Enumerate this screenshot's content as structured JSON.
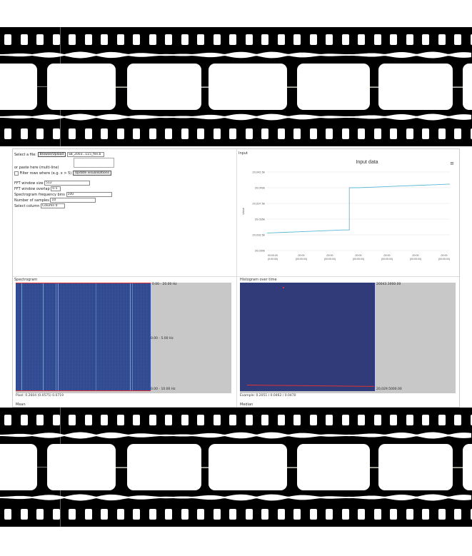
{
  "controls": {
    "select_file_label": "Select a file:",
    "browse_label": "Browse/Upload",
    "file_name": "SB_2003...L15_file.b",
    "or_paste_label": "or paste here (multi-line)",
    "filter_label": "Filter rows where",
    "filter_example": "(e.g. x > 5)",
    "update_label": "Update visualisations",
    "fft_label": "FFT window size",
    "fft_value": "512",
    "fft_overlap_label": "FFT window overlap",
    "fft_overlap_value": "0.5",
    "spec_freq_label": "Spectrogram frequency bins",
    "spec_freq_value": "100",
    "num_samples_label": "Number of samples",
    "num_samples_value": "10",
    "select_col_label": "Select column",
    "select_col_value": "Column 0"
  },
  "input_panel": {
    "title": "Input",
    "menu_icon": "hamburger-icon"
  },
  "chart_data": {
    "type": "line",
    "title": "Input data",
    "ylabel": "Value",
    "y_ticks": [
      "20,042.5k",
      "20,040k",
      "20,037.5k",
      "20,035k",
      "20,032.5k",
      "20,030k"
    ],
    "x_ticks": [
      "00:00:00\n(0:00:00)",
      "00:00\n(00:00:00)",
      "00:00\n(00:00:00)",
      "00:00\n(00:00:00)",
      "00:00\n(00:00:00)",
      "00:00\n(00:00:00)",
      "00:00\n(00:00:00)"
    ],
    "ylim": [
      20030,
      20043
    ],
    "x": [
      0,
      1,
      2,
      3,
      4,
      5,
      6,
      7,
      8,
      9,
      10,
      11,
      12
    ],
    "series": [
      {
        "values": [
          20032.9,
          20033.0,
          20033.1,
          20033.2,
          20033.3,
          20033.4,
          20040.4,
          20040.5,
          20040.6,
          20040.7,
          20040.8,
          20040.9,
          20041.0
        ],
        "color": "#5bb8d6"
      }
    ]
  },
  "spectrogram": {
    "title": "Spectrogram",
    "label_top": "0.00 - 20.00 Hz",
    "label_mid": "0.00 - 5.00 Hz",
    "label_bottom": "0.00 - 10.00 Hz",
    "footer": "Pixel: 0.2604 (0.0575) 0.0719"
  },
  "histogram": {
    "title": "Histogram over time",
    "label_top": "20043.3000.00",
    "label_bottom": "20,029.5000.00",
    "footer": "Example: 0.2051 / 0.0462 / 0.0470"
  },
  "bottom_panels": {
    "left_title": "Mean",
    "right_title": "Median"
  }
}
